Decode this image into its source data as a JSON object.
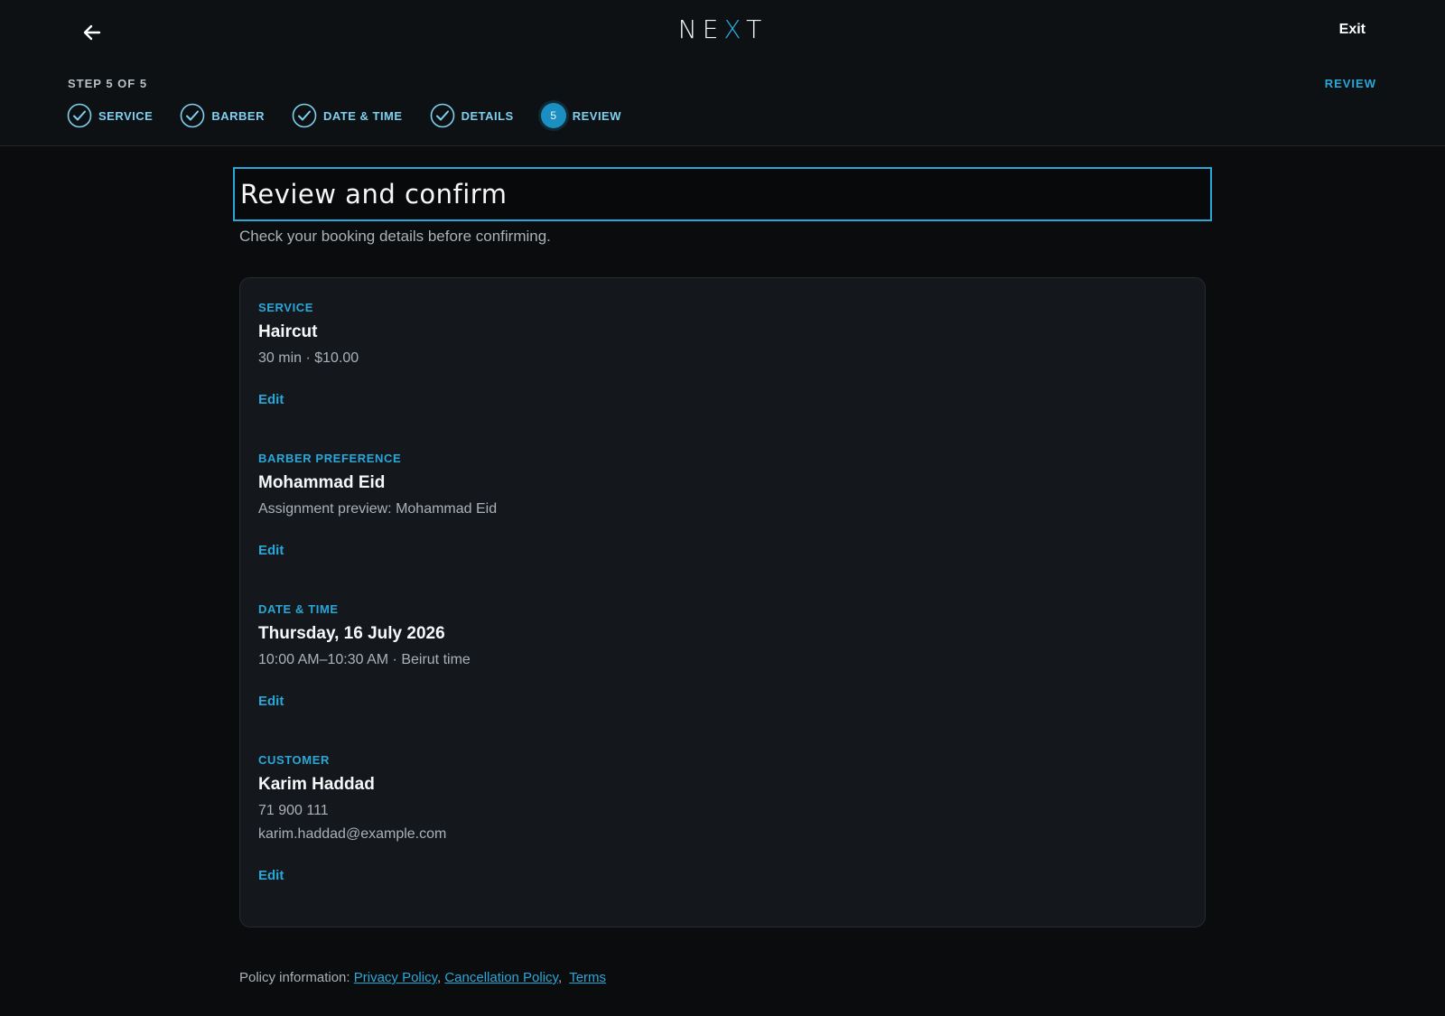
{
  "header": {
    "logo_prefix": "NE",
    "logo_accent": "X",
    "logo_suffix": "T",
    "exit_label": "Exit",
    "step_counter": "STEP 5 OF 5",
    "current_step_label": "REVIEW"
  },
  "steps": [
    {
      "label": "SERVICE",
      "state": "done"
    },
    {
      "label": "BARBER",
      "state": "done"
    },
    {
      "label": "DATE & TIME",
      "state": "done"
    },
    {
      "label": "DETAILS",
      "state": "done"
    },
    {
      "label": "REVIEW",
      "state": "current",
      "number": "5"
    }
  ],
  "main": {
    "title": "Review and confirm",
    "subtitle": "Check your booking details before confirming."
  },
  "sections": {
    "service": {
      "label": "SERVICE",
      "title": "Haircut",
      "line1": "30 min · $10.00",
      "edit": "Edit"
    },
    "barber": {
      "label": "BARBER PREFERENCE",
      "title": "Mohammad Eid",
      "line1": "Assignment preview: Mohammad Eid",
      "edit": "Edit"
    },
    "datetime": {
      "label": "DATE & TIME",
      "title": "Thursday, 16 July 2026",
      "line1": "10:00 AM–10:30 AM · Beirut time",
      "edit": "Edit"
    },
    "customer": {
      "label": "CUSTOMER",
      "title": "Karim Haddad",
      "line1": "71 900 111",
      "line2": "karim.haddad@example.com",
      "edit": "Edit"
    }
  },
  "footer": {
    "policy_prefix": "Policy information:",
    "privacy": "Privacy Policy",
    "cancellation": "Cancellation Policy",
    "terms": "Terms"
  },
  "colors": {
    "accent": "#2aa7d9",
    "background": "#0a0c0e",
    "card": "#14181c"
  },
  "icons": [
    "back-arrow-icon",
    "check-circle-icon"
  ]
}
